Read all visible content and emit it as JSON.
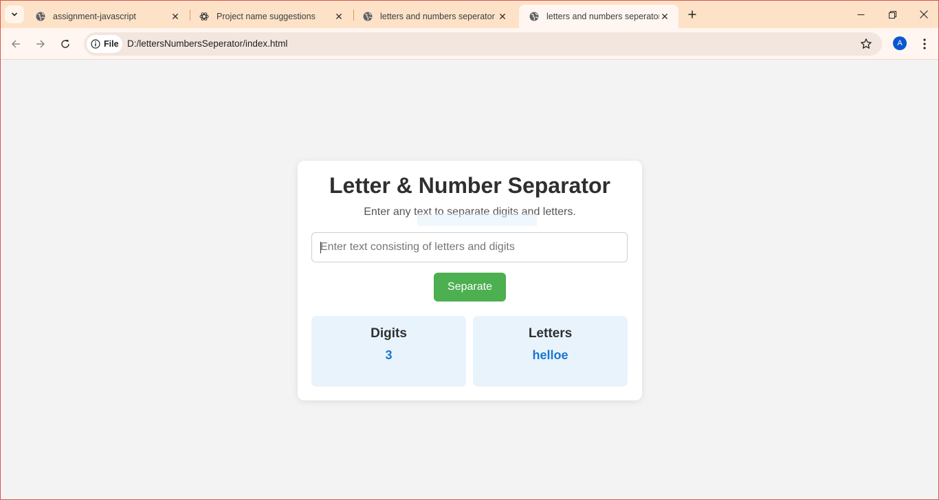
{
  "browser": {
    "tabs": [
      {
        "title": "assignment-javascript",
        "favicon": "globe-icon",
        "active": false
      },
      {
        "title": "Project name suggestions",
        "favicon": "openai-icon",
        "active": false
      },
      {
        "title": "letters and numbers seperator",
        "favicon": "globe-icon",
        "active": false
      },
      {
        "title": "letters and numbers seperator",
        "favicon": "globe-icon",
        "active": true
      }
    ],
    "site_chip_label": "File",
    "url": "D:/lettersNumbersSeperator/index.html",
    "profile_initial": "A",
    "colors": {
      "tabstrip": "#fde2c8",
      "toolbar": "#fff6f1",
      "avatar": "#0b57d0"
    }
  },
  "page": {
    "title": "Letter & Number Separator",
    "subtitle": "Enter any text to separate digits and letters.",
    "input": {
      "placeholder": "Enter text consisting of letters and digits",
      "value": ""
    },
    "button_label": "Separate",
    "results": {
      "digits": {
        "heading": "Digits",
        "value": "3"
      },
      "letters": {
        "heading": "Letters",
        "value": "helloe"
      }
    },
    "colors": {
      "button": "#4caf50",
      "result_bg": "#e9f3fc",
      "result_value": "#1976d2"
    }
  }
}
